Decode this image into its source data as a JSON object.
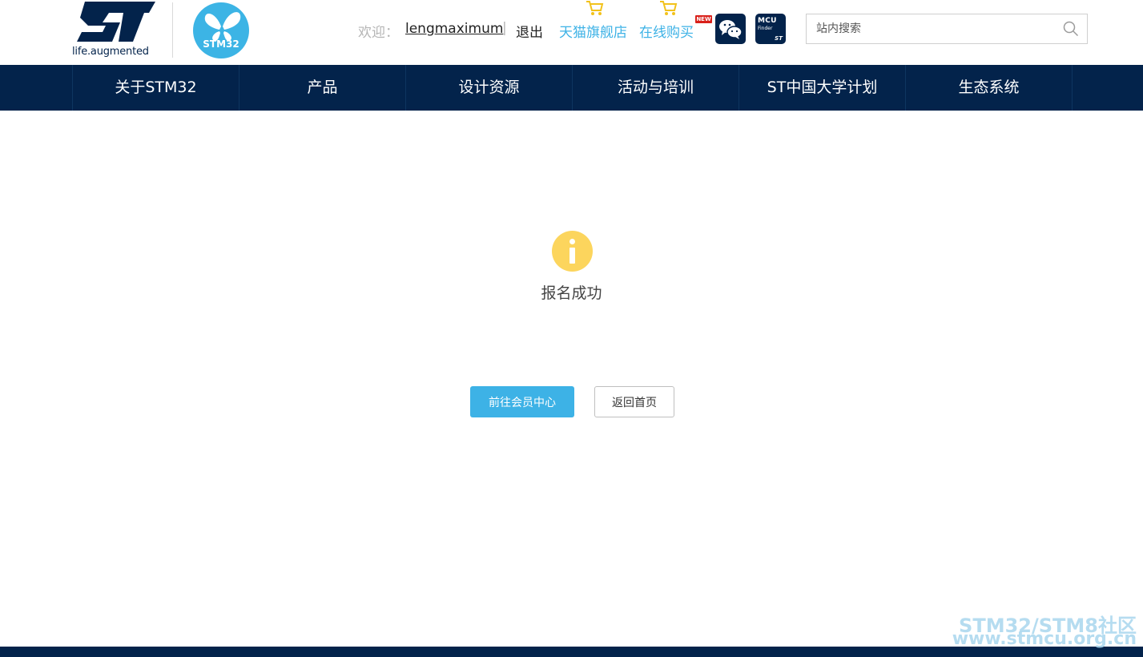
{
  "header": {
    "st_logo_text": "life.augmented",
    "stm32_logo_text": "STM32",
    "welcome_label": "欢迎：",
    "username": "lengmaximum",
    "separator": "|",
    "logout_label": "退出",
    "tmall_label": "天猫旗舰店",
    "online_buy_label": "在线购买",
    "new_badge": "NEW",
    "mcu_finder": {
      "line1": "MCU",
      "line2": "Finder",
      "brand": "ST"
    },
    "search": {
      "placeholder": "站内搜索"
    }
  },
  "nav": {
    "items": [
      {
        "label": "关于STM32"
      },
      {
        "label": "产品"
      },
      {
        "label": "设计资源"
      },
      {
        "label": "活动与培训"
      },
      {
        "label": "ST中国大学计划"
      },
      {
        "label": "生态系统"
      }
    ]
  },
  "main": {
    "message": "报名成功",
    "member_center_button": "前往会员中心",
    "home_button": "返回首页"
  },
  "watermark": {
    "line1": "STM32/STM8社区",
    "line2": "www.stmcu.org.cn"
  },
  "colors": {
    "brand_navy": "#03234b",
    "accent_blue": "#3db2e6",
    "info_yellow": "#fcd55d"
  }
}
